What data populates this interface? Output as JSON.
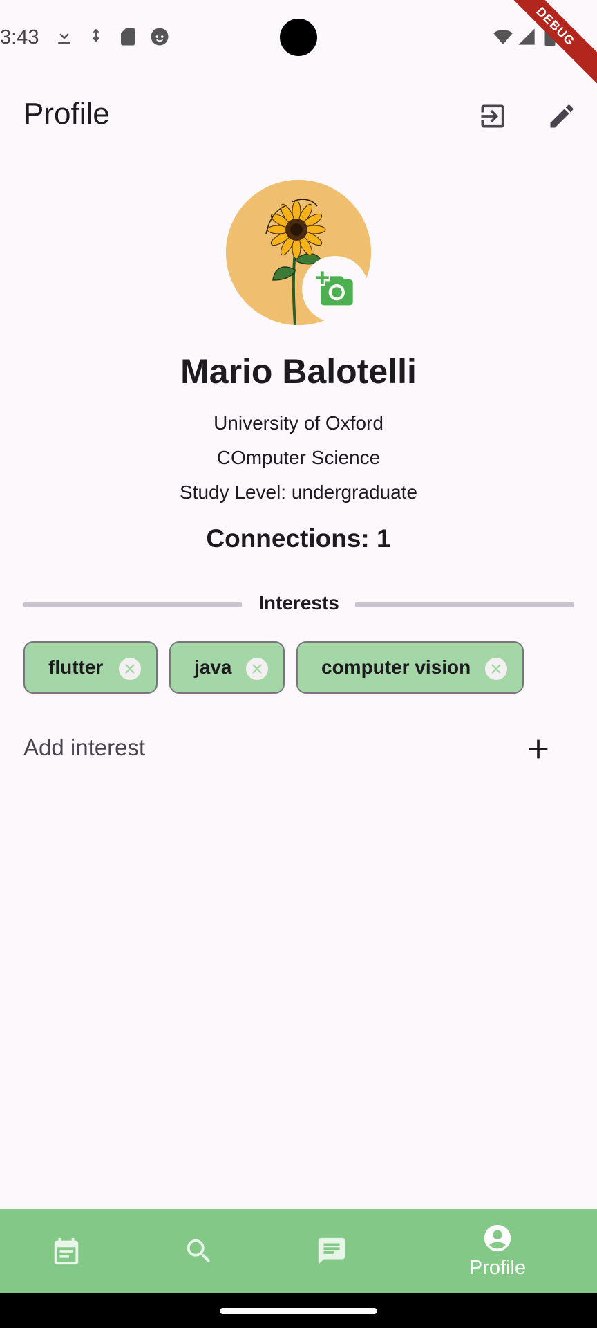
{
  "status_bar": {
    "time": "3:43",
    "debug_label": "DEBUG",
    "icons": [
      "download-icon",
      "sd-card-alt-icon",
      "sd-card-icon",
      "face-icon",
      "wifi-icon",
      "signal-icon",
      "battery-icon"
    ]
  },
  "app_bar": {
    "title": "Profile",
    "actions": [
      "logout-icon",
      "edit-icon"
    ]
  },
  "profile": {
    "name": "Mario Balotelli",
    "university": "University of Oxford",
    "course": "COmputer Science",
    "study_level": "Study Level: undergraduate",
    "connections": "Connections: 1",
    "avatar_text": "You're a sunflower"
  },
  "interests": {
    "heading": "Interests",
    "chips": [
      {
        "label": "flutter"
      },
      {
        "label": "java"
      },
      {
        "label": "computer vision"
      }
    ],
    "add_label": "Add interest"
  },
  "bottom_nav": {
    "items": [
      {
        "icon": "feed-icon",
        "label": ""
      },
      {
        "icon": "search-icon",
        "label": ""
      },
      {
        "icon": "chat-icon",
        "label": ""
      },
      {
        "icon": "account-circle-icon",
        "label": "Profile",
        "selected": true
      }
    ],
    "background": "#84c887"
  },
  "colors": {
    "background": "#fdf8fc",
    "chip": "#a5d6a7",
    "accent_green": "#4caf50",
    "avatar_bg": "#efbe6e"
  }
}
